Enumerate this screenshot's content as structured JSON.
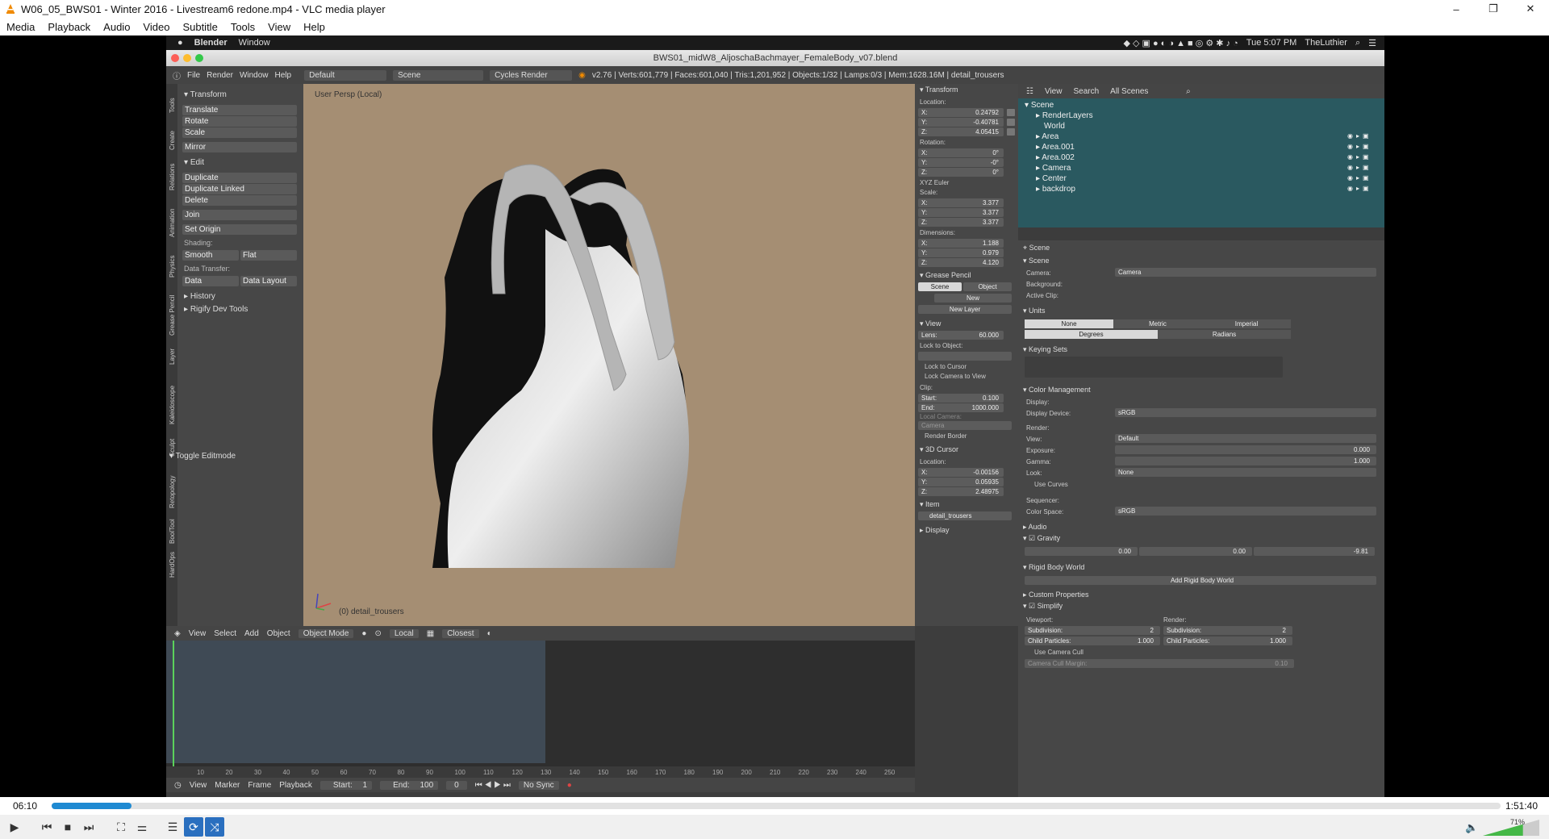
{
  "window": {
    "title": "W06_05_BWS01 - Winter 2016 - Livestream6 redone.mp4 - VLC media player",
    "icon": "vlc-cone-icon",
    "controls": {
      "minimize": "–",
      "restore": "❐",
      "close": "✕"
    }
  },
  "menubar": [
    "Media",
    "Playback",
    "Audio",
    "Video",
    "Subtitle",
    "Tools",
    "View",
    "Help"
  ],
  "mac_menubar": {
    "apple": "",
    "app": "Blender",
    "menu": "Window",
    "clock": "Tue 5:07 PM",
    "user": "TheLuthier"
  },
  "blender": {
    "file_title": "BWS01_midW8_AljoschaBachmayer_FemaleBody_v07.blend",
    "info_header": {
      "menus": [
        "File",
        "Render",
        "Window",
        "Help"
      ],
      "layout": "Default",
      "scene": "Scene",
      "engine": "Cycles Render",
      "stats": "v2.76 | Verts:601,779 | Faces:601,040 | Tris:1,201,952 | Objects:1/32 | Lamps:0/3 | Mem:1628.16M | detail_trousers"
    },
    "tool_tabs": [
      "Tools",
      "Create",
      "Relations",
      "Animation",
      "Physics",
      "Grease Pencil",
      "Layer",
      "Kaleidoscope",
      "Sculpt",
      "Retopology",
      "BoolTool",
      "HardOps"
    ],
    "tool_shelf": {
      "transform_header": "Transform",
      "transform": [
        "Translate",
        "Rotate",
        "Scale",
        "Mirror"
      ],
      "edit_header": "Edit",
      "edit": [
        "Duplicate",
        "Duplicate Linked",
        "Delete",
        "Join",
        "Set Origin"
      ],
      "shading_label": "Shading:",
      "shading": [
        "Smooth",
        "Flat"
      ],
      "data_transfer_label": "Data Transfer:",
      "data_transfer": [
        "Data",
        "Data Layout"
      ],
      "history": "History",
      "rigify": "Rigify Dev Tools",
      "toggle_editmode": "Toggle Editmode"
    },
    "viewport": {
      "persp_label": "User Persp (Local)",
      "object_label": "(0) detail_trousers"
    },
    "npanel": {
      "transform": "Transform",
      "location": "Location:",
      "loc": {
        "x": "X:",
        "y": "Y:",
        "z": "Z:",
        "xv": "0.24792",
        "yv": "-0.40781",
        "zv": "4.05415"
      },
      "rotation": "Rotation:",
      "rot": {
        "xv": "0°",
        "yv": "-0°",
        "zv": "0°"
      },
      "euler": "XYZ Euler",
      "scale": "Scale:",
      "scl": {
        "xv": "3.377",
        "yv": "3.377",
        "zv": "3.377"
      },
      "dimensions": "Dimensions:",
      "dim": {
        "xv": "1.188",
        "yv": "0.979",
        "zv": "4.120"
      },
      "grease_pencil": "Grease Pencil",
      "gp_scene": "Scene",
      "gp_object": "Object",
      "gp_new": "New",
      "gp_new_layer": "New Layer",
      "view": "View",
      "lens_label": "Lens:",
      "lens": "60.000",
      "lock_to_object": "Lock to Object:",
      "lock_to_cursor": "Lock to Cursor",
      "lock_camera": "Lock Camera to View",
      "clip": "Clip:",
      "clip_start_label": "Start:",
      "clip_start": "0.100",
      "clip_end_label": "End:",
      "clip_end": "1000.000",
      "local_camera": "Local Camera:",
      "camera": "Camera",
      "render_border": "Render Border",
      "cursor_3d": "3D Cursor",
      "cursor_location": "Location:",
      "cur": {
        "xv": "-0.00156",
        "yv": "0.05935",
        "zv": "2.48975"
      },
      "item": "Item",
      "item_name": "detail_trousers",
      "display": "Display"
    },
    "outliner": {
      "view": "View",
      "search": "Search",
      "all_scenes": "All Scenes",
      "items": [
        "Scene",
        "RenderLayers",
        "World",
        "Area",
        "Area.001",
        "Area.002",
        "Camera",
        "Center",
        "backdrop"
      ]
    },
    "properties": {
      "breadcrumb": "Scene",
      "scene_header": "Scene",
      "camera_label": "Camera:",
      "camera": "Camera",
      "background_label": "Background:",
      "active_clip_label": "Active Clip:",
      "units_header": "Units",
      "units": [
        "None",
        "Metric",
        "Imperial"
      ],
      "rotation_units": [
        "Degrees",
        "Radians"
      ],
      "keying_sets": "Keying Sets",
      "color_management": "Color Management",
      "display_label": "Display:",
      "display_device_label": "Display Device:",
      "display_device": "sRGB",
      "render_label": "Render:",
      "view_label": "View:",
      "view": "Default",
      "exposure_label": "Exposure:",
      "exposure": "0.000",
      "gamma_label": "Gamma:",
      "gamma": "1.000",
      "look_label": "Look:",
      "look": "None",
      "use_curves": "Use Curves",
      "sequencer_label": "Sequencer:",
      "color_space_label": "Color Space:",
      "color_space": "sRGB",
      "audio": "Audio",
      "gravity": "Gravity",
      "gravity_x": "0.00",
      "gravity_y": "0.00",
      "gravity_z": "-9.81",
      "rigid_body_world": "Rigid Body World",
      "add_rigid_body": "Add Rigid Body World",
      "custom_properties": "Custom Properties",
      "simplify": "Simplify",
      "viewport_label": "Viewport:",
      "render_col_label": "Render:",
      "subdivision_label": "Subdivision:",
      "subdivision_vp": "2",
      "subdivision_r": "2",
      "child_particles_label": "Child Particles:",
      "child_particles_vp": "1.000",
      "child_particles_r": "1.000",
      "use_camera_cull": "Use Camera Cull",
      "camera_cull_margin_label": "Camera Cull Margin:",
      "camera_cull_margin": "0.10"
    },
    "view3d_header": {
      "menus": [
        "View",
        "Select",
        "Add",
        "Object"
      ],
      "mode": "Object Mode",
      "pivot": "Local",
      "snap": "Closest"
    },
    "timeline": {
      "ticks": [
        "10",
        "20",
        "30",
        "40",
        "50",
        "60",
        "70",
        "80",
        "90",
        "100",
        "110",
        "120",
        "130",
        "140",
        "150",
        "160",
        "170",
        "180",
        "190",
        "200",
        "210",
        "220",
        "230",
        "240",
        "250"
      ],
      "menus": [
        "View",
        "Marker",
        "Frame",
        "Playback"
      ],
      "start_label": "Start:",
      "start": "1",
      "end_label": "End:",
      "end": "100",
      "current": "0",
      "sync": "No Sync"
    }
  },
  "player": {
    "elapsed": "06:10",
    "total": "1:51:40",
    "progress": 0.055,
    "volume": "71%",
    "volume_level": 0.71
  },
  "colors": {
    "accent": "#2a6fbf",
    "progress": "#1f8ad2",
    "blender_bg": "#3d3d3d",
    "viewport": "#a58e73"
  }
}
